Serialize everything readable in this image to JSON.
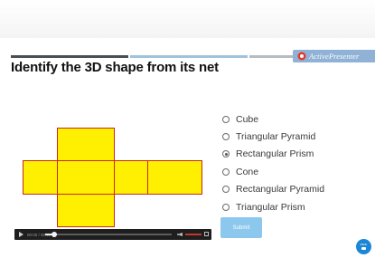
{
  "question": {
    "title": "Identify the 3D shape from its net"
  },
  "brand": {
    "name": "ActivePresenter",
    "icon": "activepresenter-logo-icon"
  },
  "progress": {
    "segments": [
      "completed",
      "current",
      "remaining"
    ]
  },
  "net": {
    "shape_description_icon": "rectangular-prism-net",
    "fill_color": "#ffef00",
    "edge_color": "#c8291a",
    "face_count": 6
  },
  "player": {
    "time": "00:00 / 00:12",
    "played_fraction": 0.07,
    "volume_fraction": 0.8,
    "icons": [
      "play-icon",
      "volume-icon",
      "fullscreen-icon"
    ]
  },
  "options": [
    {
      "label": "Cube",
      "selected": false
    },
    {
      "label": "Triangular Pyramid",
      "selected": false
    },
    {
      "label": "Rectangular Prism",
      "selected": true
    },
    {
      "label": "Cone",
      "selected": false
    },
    {
      "label": "Rectangular Pyramid",
      "selected": false
    },
    {
      "label": "Triangular Prism",
      "selected": false
    }
  ],
  "submit": {
    "label": "Submit"
  },
  "corner_button": {
    "label": "MENU",
    "icon": "menu-icon"
  },
  "colors": {
    "accent": "#8cc7ee",
    "brand_bar": "#8fb2d6",
    "corner": "#1a86d6"
  }
}
